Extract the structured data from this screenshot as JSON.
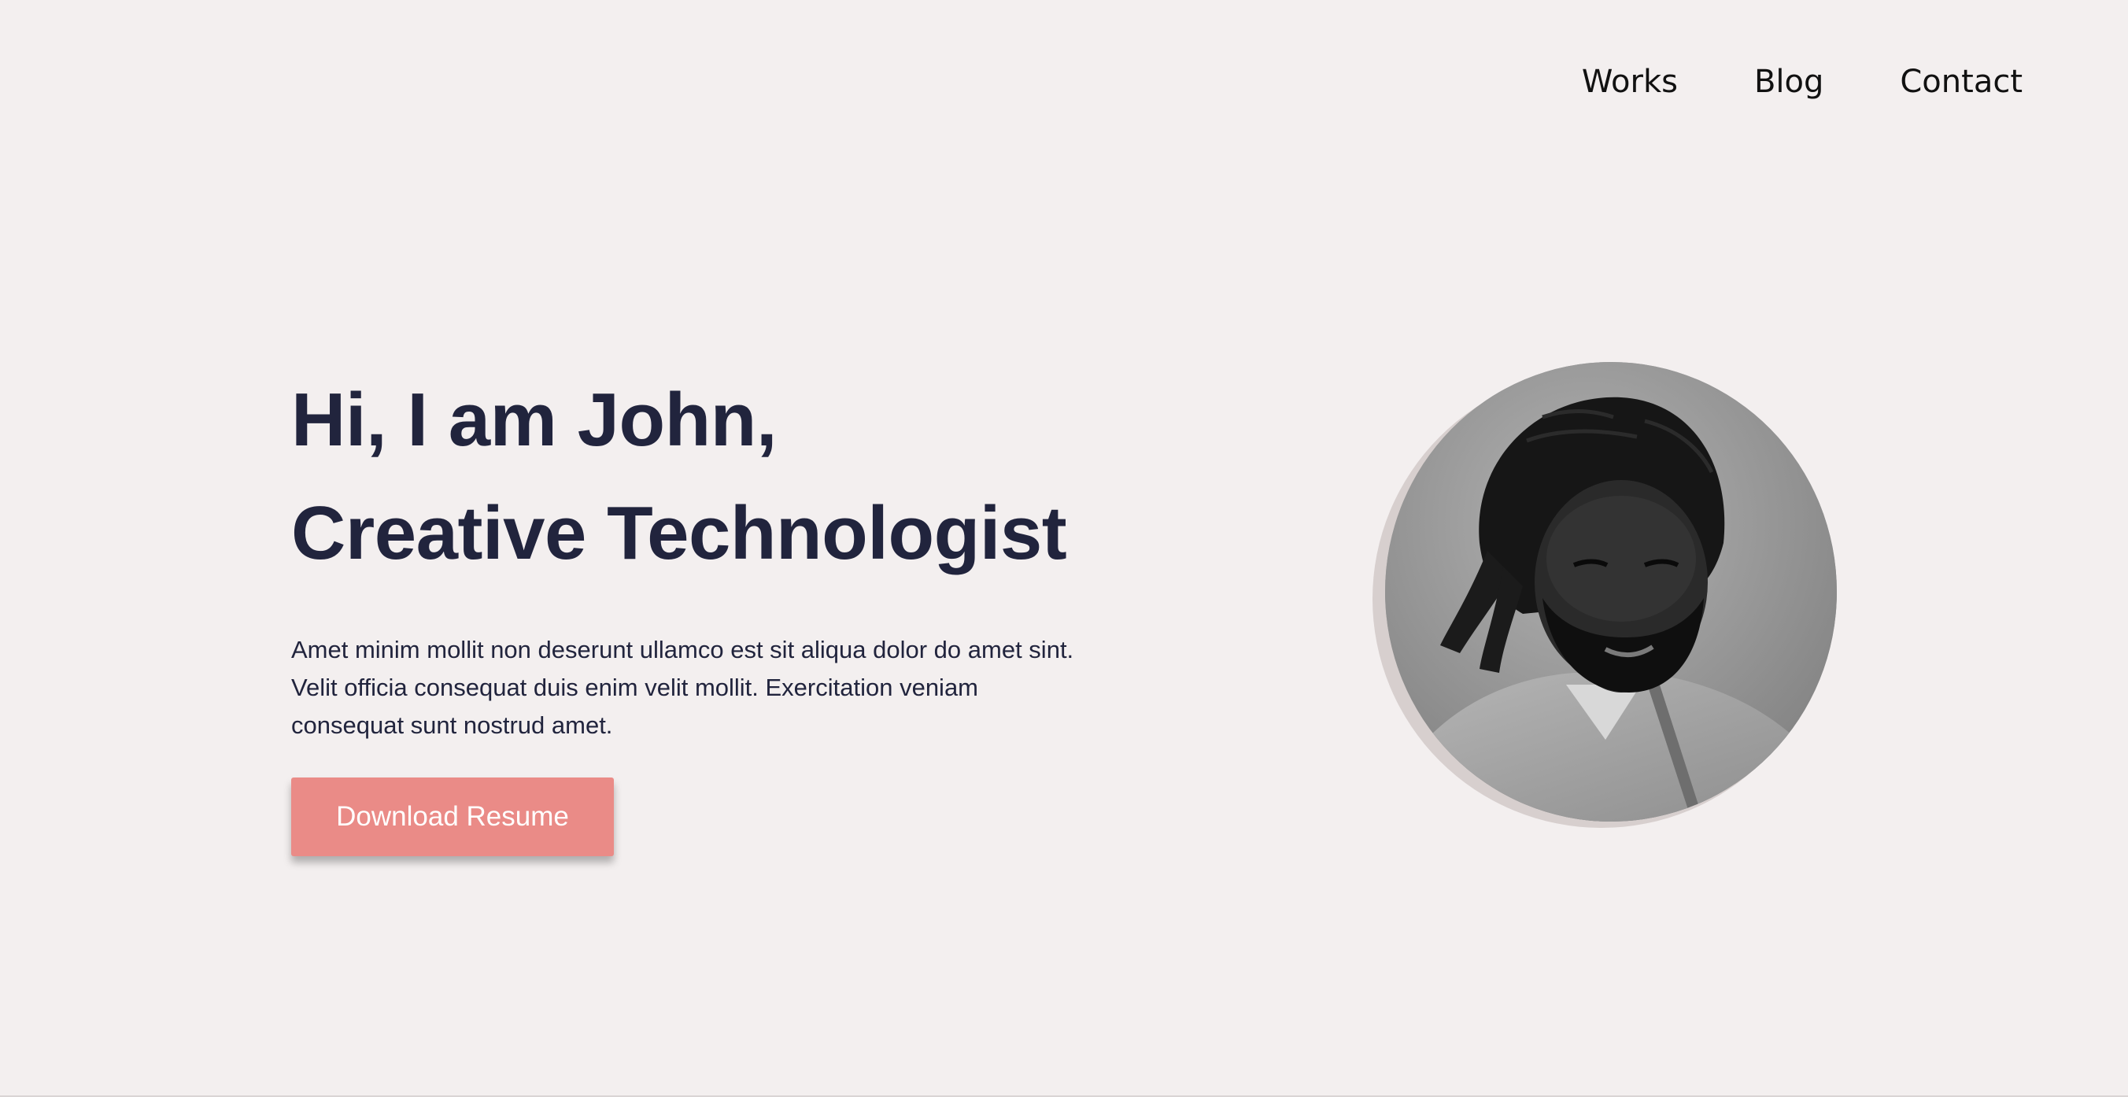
{
  "nav": {
    "items": [
      {
        "label": "Works"
      },
      {
        "label": "Blog"
      },
      {
        "label": "Contact"
      }
    ]
  },
  "hero": {
    "title_line1": "Hi, I am John,",
    "title_line2": "Creative Technologist",
    "description": "Amet minim mollit non deserunt ullamco est sit aliqua dolor do amet sint. Velit officia consequat duis enim velit mollit. Exercitation veniam consequat sunt nostrud amet.",
    "cta_label": "Download Resume"
  },
  "colors": {
    "background": "#f3efef",
    "text": "#21243d",
    "accent": "#ea8b87",
    "button_text": "#ffffff"
  },
  "profile_photo": {
    "icon": "profile-photo"
  }
}
